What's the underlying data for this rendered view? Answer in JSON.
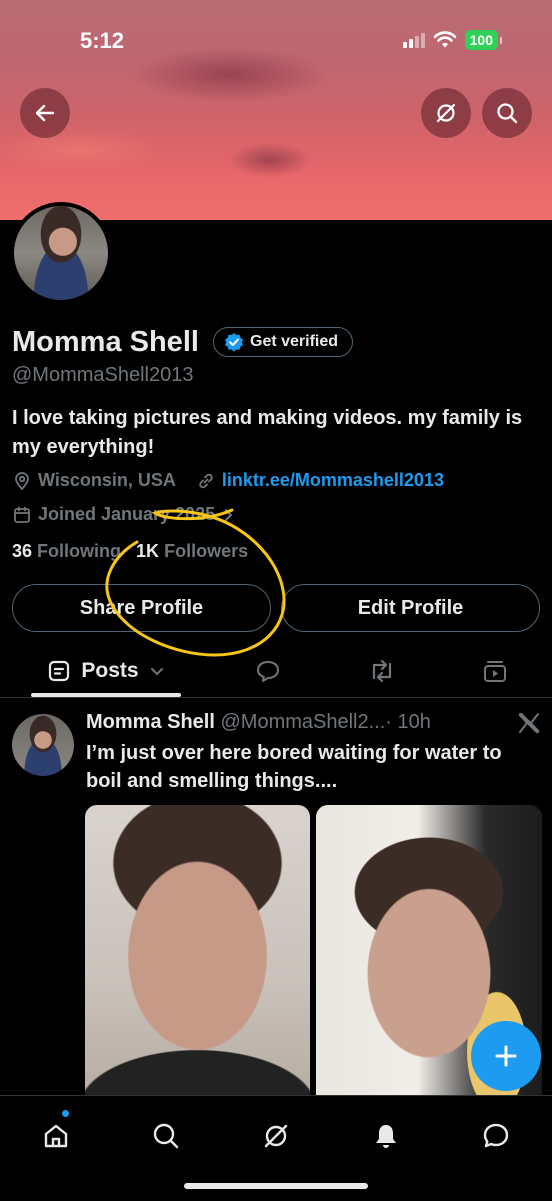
{
  "status_bar": {
    "time": "5:12",
    "battery": "100"
  },
  "profile": {
    "name": "Momma Shell",
    "verified_label": "Get verified",
    "handle": "@MommaShell2013",
    "bio": "I love taking pictures and making videos. my family is my everything!",
    "location": "Wisconsin, USA",
    "link": "linktr.ee/Mommashell2013",
    "joined": "Joined January 2025",
    "following_count": "36",
    "following_label": "Following",
    "followers_count": "1K",
    "followers_label": "Followers",
    "share_button": "Share Profile",
    "edit_button": "Edit Profile"
  },
  "tabs": {
    "posts_label": "Posts"
  },
  "post": {
    "author": "Momma Shell",
    "handle": "@MommaShell2...",
    "time": "· 10h",
    "text": "I’m just over here bored waiting for water to boil and smelling things...."
  },
  "colors": {
    "accent": "#1d9bf0",
    "annotation": "#f5c518",
    "background": "#000000"
  },
  "icons": [
    "back-arrow-icon",
    "grok-icon",
    "search-icon",
    "verified-badge-icon",
    "location-icon",
    "link-icon",
    "calendar-icon",
    "chevron-down-icon",
    "reply-icon",
    "repost-icon",
    "media-icon",
    "x-logo-icon",
    "plus-icon",
    "home-icon",
    "bell-icon",
    "messages-icon"
  ]
}
